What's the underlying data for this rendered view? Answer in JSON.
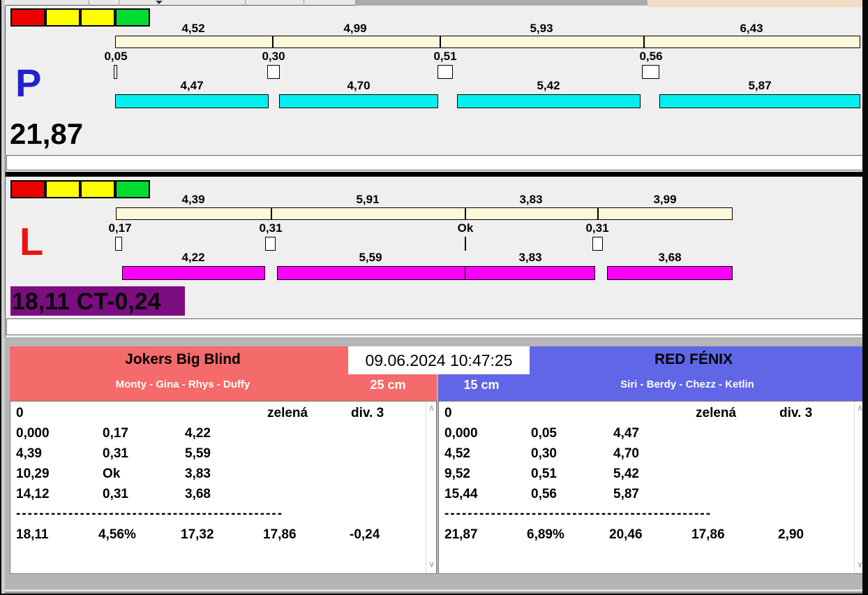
{
  "colors": {
    "panel_bg": "#EFEFEF",
    "legend_red": "#EE0000",
    "legend_yellow": "#FFFF00",
    "legend_green": "#00DC32",
    "split_bar": "#FBF9D9",
    "lane_p_bar": "#00F0F0",
    "lane_l_bar": "#FA00FA",
    "lane_l_total_bg": "#7B0D80",
    "lane_p_letter": "#2222CC",
    "lane_l_letter": "#EE1111",
    "team_left_header": "#F56A6A",
    "team_right_header": "#6066E6",
    "section_bg": "#B5B5B5",
    "top_strip_beige": "#F2DCC3"
  },
  "lanes": {
    "p": {
      "label": "P",
      "total": "21,87",
      "splits": [
        "4,52",
        "4,99",
        "5,93",
        "6,43"
      ],
      "passes": [
        "0,05",
        "0,30",
        "0,51",
        "0,56"
      ],
      "runs": [
        "4,47",
        "4,70",
        "5,42",
        "5,87"
      ]
    },
    "l": {
      "label": "L",
      "total": "18,11 CT-0,24",
      "splits": [
        "4,39",
        "5,91",
        "3,83",
        "3,99"
      ],
      "passes": [
        "0,17",
        "0,31",
        "Ok",
        "0,31"
      ],
      "runs": [
        "4,22",
        "5,59",
        "3,83",
        "3,68"
      ]
    }
  },
  "timestamp": "09.06.2024 10:47:25",
  "teams": {
    "left": {
      "name": "Jokers Big Blind",
      "members": "Monty - Gina - Rhys - Duffy",
      "jump_height": "25 cm",
      "start_value": "0",
      "light": "zelená",
      "division": "div. 3",
      "rows": [
        [
          "0,000",
          "0,17",
          "4,22"
        ],
        [
          "4,39",
          "0,31",
          "5,59"
        ],
        [
          "10,29",
          "Ok",
          "3,83"
        ],
        [
          "14,12",
          "0,31",
          "3,68"
        ]
      ],
      "separator": "----------------------------------------------",
      "totals": [
        "18,11",
        "4,56%",
        "17,32",
        "17,86",
        "-0,24"
      ]
    },
    "right": {
      "name": "RED FÉNIX",
      "members": "Siri - Berdy - Chezz - Ketlin",
      "jump_height": "15 cm",
      "start_value": "0",
      "light": "zelená",
      "division": "div. 3",
      "rows": [
        [
          "0,000",
          "0,05",
          "4,47"
        ],
        [
          "4,52",
          "0,30",
          "4,70"
        ],
        [
          "9,52",
          "0,51",
          "5,42"
        ],
        [
          "15,44",
          "0,56",
          "5,87"
        ]
      ],
      "separator": "----------------------------------------------",
      "totals": [
        "21,87",
        "6,89%",
        "20,46",
        "17,86",
        "2,90"
      ]
    }
  }
}
